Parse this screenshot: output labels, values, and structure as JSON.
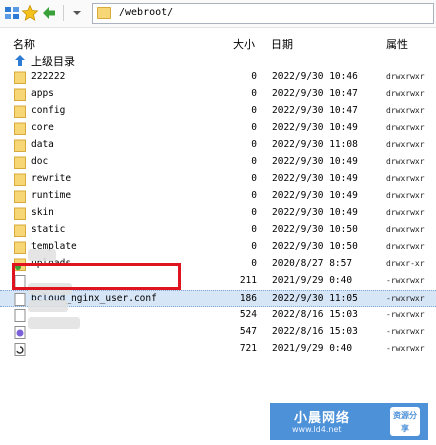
{
  "toolbar": {
    "icons": [
      "settings-icon",
      "favorite-star-icon",
      "back-arrow-icon"
    ]
  },
  "address": {
    "path": "/webroot/"
  },
  "columns": {
    "name": "名称",
    "size": "大小",
    "date": "日期",
    "attr": "属性"
  },
  "parent_dir": "上级目录",
  "files": [
    {
      "name": "222222",
      "type": "folder",
      "size": "0",
      "date": "2022/9/30 10:46",
      "perm": "drwxrwxr"
    },
    {
      "name": "apps",
      "type": "folder",
      "size": "0",
      "date": "2022/9/30 10:47",
      "perm": "drwxrwxr"
    },
    {
      "name": "config",
      "type": "folder",
      "size": "0",
      "date": "2022/9/30 10:47",
      "perm": "drwxrwxr"
    },
    {
      "name": "core",
      "type": "folder",
      "size": "0",
      "date": "2022/9/30 10:49",
      "perm": "drwxrwxr"
    },
    {
      "name": "data",
      "type": "folder",
      "size": "0",
      "date": "2022/9/30 11:08",
      "perm": "drwxrwxr"
    },
    {
      "name": "doc",
      "type": "folder",
      "size": "0",
      "date": "2022/9/30 10:49",
      "perm": "drwxrwxr"
    },
    {
      "name": "rewrite",
      "type": "folder",
      "size": "0",
      "date": "2022/9/30 10:49",
      "perm": "drwxrwxr"
    },
    {
      "name": "runtime",
      "type": "folder",
      "size": "0",
      "date": "2022/9/30 10:49",
      "perm": "drwxrwxr"
    },
    {
      "name": "skin",
      "type": "folder",
      "size": "0",
      "date": "2022/9/30 10:49",
      "perm": "drwxrwxr"
    },
    {
      "name": "static",
      "type": "folder",
      "size": "0",
      "date": "2022/9/30 10:50",
      "perm": "drwxrwxr"
    },
    {
      "name": "template",
      "type": "folder",
      "size": "0",
      "date": "2022/9/30 10:50",
      "perm": "drwxrwxr"
    },
    {
      "name": "uploads",
      "type": "folder-special",
      "size": "0",
      "date": "2020/8/27 8:57",
      "perm": "drwxr-xr"
    },
    {
      "name": "",
      "type": "file",
      "size": "211",
      "date": "2021/9/29 0:40",
      "perm": "-rwxrwxr"
    },
    {
      "name": "bcloud_nginx_user.conf",
      "type": "file",
      "size": "186",
      "date": "2022/9/30 11:05",
      "perm": "-rwxrwxr",
      "selected": true
    },
    {
      "name": "",
      "type": "file",
      "size": "524",
      "date": "2022/8/16 15:03",
      "perm": "-rwxrwxr"
    },
    {
      "name": "",
      "type": "file-php",
      "size": "547",
      "date": "2022/8/16 15:03",
      "perm": "-rwxrwxr"
    },
    {
      "name": "",
      "type": "file-special",
      "size": "721",
      "date": "2021/9/29 0:40",
      "perm": "-rwxrwxr"
    }
  ],
  "watermark": {
    "title": "小晨网络",
    "url": "www.ld4.net",
    "badge": "资源分享"
  }
}
